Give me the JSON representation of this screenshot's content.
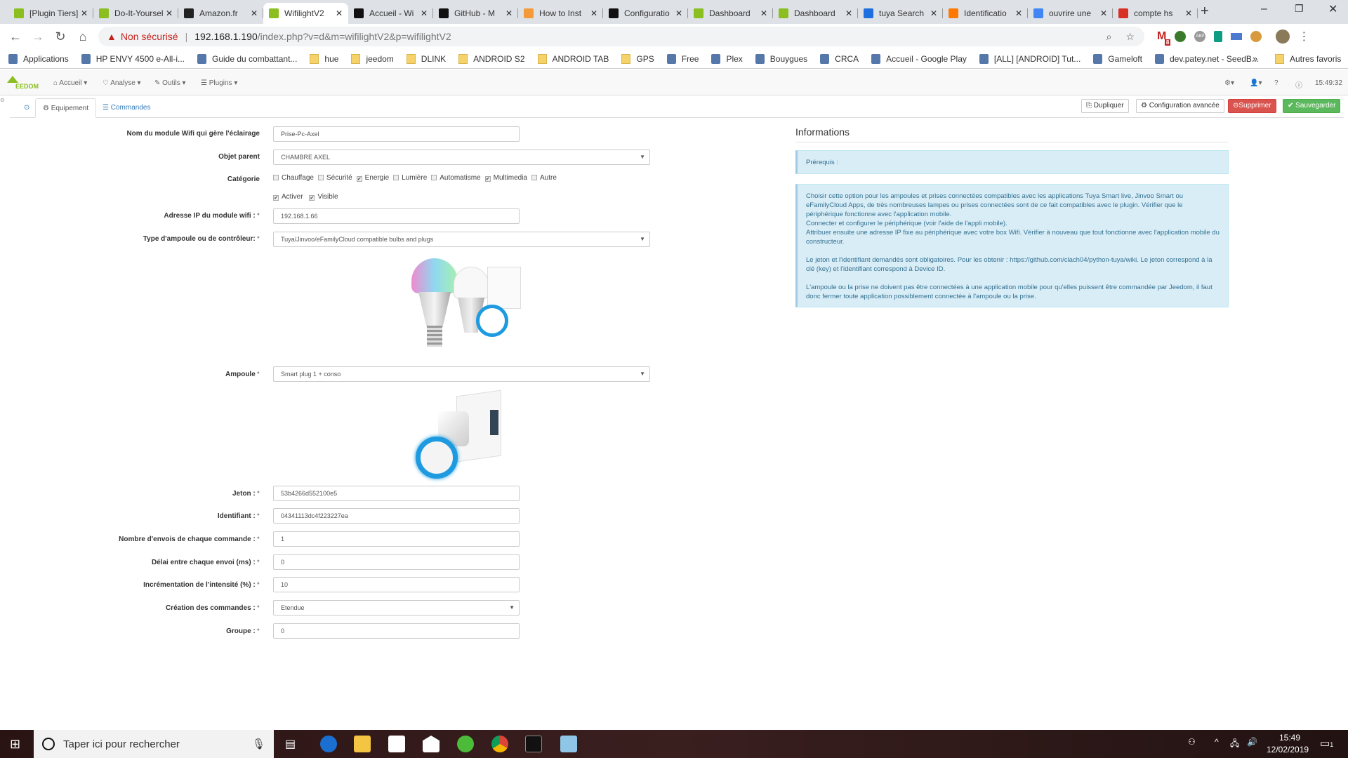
{
  "browser": {
    "tabs": [
      {
        "title": "[Plugin Tiers]",
        "favicon": "jeedom-icon"
      },
      {
        "title": "Do-It-Yourself",
        "favicon": "jeedom-icon"
      },
      {
        "title": "Amazon.fr",
        "favicon": "amazon-icon"
      },
      {
        "title": "WifilightV2",
        "favicon": "jeedom-icon",
        "active": true
      },
      {
        "title": "Accueil - Wi",
        "favicon": "github-icon"
      },
      {
        "title": "GitHub - M",
        "favicon": "github-icon"
      },
      {
        "title": "How to Inst",
        "favicon": "xda-icon"
      },
      {
        "title": "Configuratio",
        "favicon": "github-icon"
      },
      {
        "title": "Dashboard",
        "favicon": "jeedom-icon"
      },
      {
        "title": "Dashboard",
        "favicon": "jeedom-icon"
      },
      {
        "title": "tuya Search",
        "favicon": "tuya-icon"
      },
      {
        "title": "Identificatio",
        "favicon": "orange-icon"
      },
      {
        "title": "ouvrire une",
        "favicon": "google-icon"
      },
      {
        "title": "compte hs",
        "favicon": "gmail-icon"
      }
    ],
    "security_label": "Non sécurisé",
    "url_host": "192.168.1.190",
    "url_path": "/index.php?v=d&m=wifilightV2&p=wifilightV2",
    "gmail_badge": "8",
    "bookmarks": [
      "Applications",
      "HP ENVY 4500 e-All-i...",
      "Guide du combattant...",
      "hue",
      "jeedom",
      "DLINK",
      "ANDROID S2",
      "ANDROID TAB",
      "GPS",
      "Free",
      "Plex",
      "Bouygues",
      "CRCA",
      "Accueil - Google Play",
      "[ALL] [ANDROID] Tut...",
      "Gameloft",
      "dev.patey.net - SeedB..."
    ],
    "bookmarks_more": "»",
    "other_bookmarks": "Autres favoris"
  },
  "jeedom": {
    "logo": "EEDOM",
    "menu": [
      "Accueil",
      "Analyse",
      "Outils",
      "Plugins"
    ],
    "clock": "15:49:32",
    "tabs": {
      "equipement": "Equipement",
      "commandes": "Commandes"
    },
    "actions": {
      "duplicate": "Dupliquer",
      "advanced": "Configuration avancée",
      "delete": "Supprimer",
      "save": "Sauvegarder"
    },
    "colors": {
      "delete": "#d9534f",
      "save": "#5cb85c",
      "info_bg": "#d9edf7"
    }
  },
  "form": {
    "name": {
      "label": "Nom du module Wifi qui gère l'éclairage",
      "value": "Prise-Pc-Axel"
    },
    "parent": {
      "label": "Objet parent",
      "value": "CHAMBRE AXEL"
    },
    "category": {
      "label": "Catégorie",
      "options": [
        {
          "name": "Chauffage",
          "checked": false
        },
        {
          "name": "Sécurité",
          "checked": false
        },
        {
          "name": "Energie",
          "checked": true
        },
        {
          "name": "Lumière",
          "checked": false
        },
        {
          "name": "Automatisme",
          "checked": false
        },
        {
          "name": "Multimedia",
          "checked": true
        },
        {
          "name": "Autre",
          "checked": false
        }
      ]
    },
    "activate": {
      "label": "Activer",
      "checked": true
    },
    "visible": {
      "label": "Visible",
      "checked": true
    },
    "ip": {
      "label": "Adresse IP du module wifi :",
      "value": "192.168.1.66"
    },
    "type": {
      "label": "Type d'ampoule ou de contrôleur:",
      "value": "Tuya/Jinvoo/eFamilyCloud compatible bulbs and plugs"
    },
    "bulb": {
      "label": "Ampoule",
      "value": "Smart plug 1 + conso"
    },
    "token": {
      "label": "Jeton :",
      "value": "53b4266d552100e5"
    },
    "id": {
      "label": "Identifiant :",
      "value": "04341113dc4f223227ea"
    },
    "sends": {
      "label": "Nombre d'envois de chaque commande :",
      "value": "1"
    },
    "delay": {
      "label": "Délai entre chaque envoi (ms) :",
      "value": "0"
    },
    "increment": {
      "label": "Incrémentation de l'intensité (%) :",
      "value": "10"
    },
    "creation": {
      "label": "Création des commandes :",
      "value": "Etendue"
    },
    "group": {
      "label": "Groupe :",
      "value": "0"
    }
  },
  "info": {
    "title": "Informations",
    "prereq": "Prérequis :",
    "p1": "Choisir cette option pour les ampoules et prises connectées compatibles avec les applications Tuya Smart live, Jinvoo Smart ou eFamilyCloud Apps, de très nombreuses lampes ou prises connectées sont de ce fait compatibles avec le plugin. Vérifier que le périphérique fonctionne avec l'application mobile.",
    "p2": "Connecter et configurer le périphérique (voir l'aide de l'appli mobile).",
    "p3": "Attribuer ensuite une adresse IP fixe au périphérique avec votre box Wifi. Vérifier à nouveau que tout fonctionne avec l'application mobile du constructeur.",
    "p4": "Le jeton et l'identifiant demandés sont obligatoires. Pour les obtenir : https://github.com/clach04/python-tuya/wiki. Le jeton correspond à la clé (key) et l'identifiant correspond à Device ID.",
    "p5": "L'ampoule ou la prise ne doivent pas être connectées à une application mobile pour qu'elles puissent être commandée par Jeedom, il faut donc fermer toute application possiblement connectée à l'ampoule ou la prise."
  },
  "taskbar": {
    "search_placeholder": "Taper ici pour rechercher",
    "time": "15:49",
    "date": "12/02/2019",
    "notifications": "1"
  }
}
